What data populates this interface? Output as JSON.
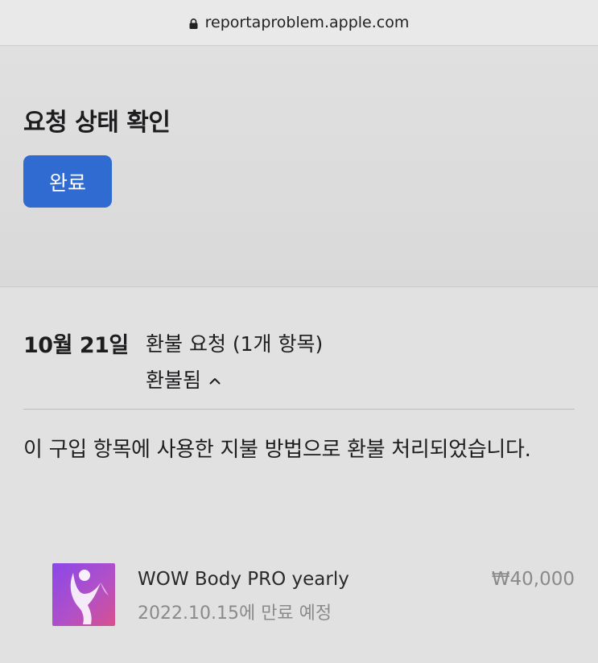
{
  "browser": {
    "url": "reportaproblem.apple.com"
  },
  "header": {
    "title": "요청 상태 확인",
    "status_button_label": "완료"
  },
  "request": {
    "date": "10월 21일",
    "title": "환불 요청 (1개 항목)",
    "status": "환불됨",
    "message": "이 구입 항목에 사용한 지불 방법으로 환불 처리되었습니다."
  },
  "item": {
    "name": "WOW Body PRO yearly",
    "expiry": "2022.10.15에 만료 예정",
    "price": "₩40,000"
  },
  "colors": {
    "accent": "#2f6bd1",
    "background": "#e1e1e1",
    "muted_text": "#8a8a8a"
  }
}
